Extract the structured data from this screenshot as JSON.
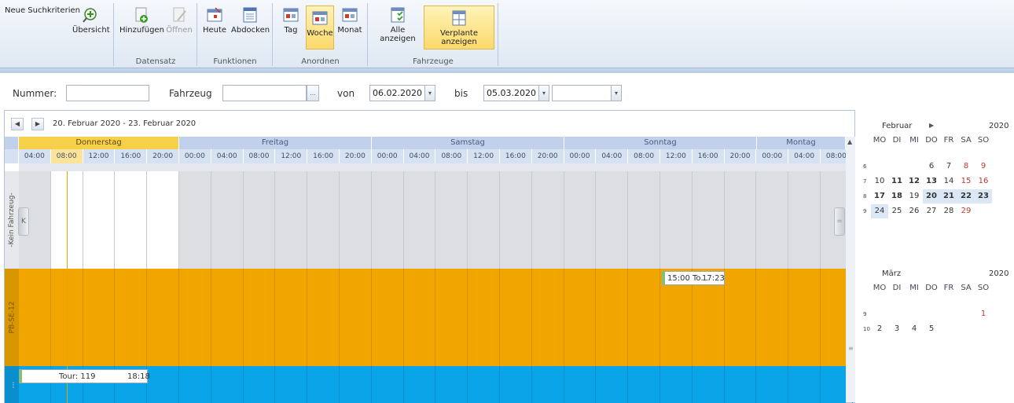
{
  "ribbon": {
    "neue_suchkriterien": "Neue Suchkriterien",
    "buttons": {
      "uebersicht": "Übersicht",
      "hinzufuegen": "Hinzufügen",
      "oeffnen": "Öffnen",
      "heute": "Heute",
      "abdocken": "Abdocken",
      "tag": "Tag",
      "woche": "Woche",
      "monat": "Monat",
      "alle_anzeigen": "Alle anzeigen",
      "verplante_anzeigen": "Verplante anzeigen"
    },
    "groups": {
      "datensatz": "Datensatz",
      "funktionen": "Funktionen",
      "anordnen": "Anordnen",
      "fahrzeuge": "Fahrzeuge"
    }
  },
  "filter": {
    "nummer_label": "Nummer:",
    "nummer_value": "",
    "fahrzeug_label": "Fahrzeug",
    "fahrzeug_value": "",
    "ellipsis": "...",
    "von_label": "von",
    "von_value": "06.02.2020",
    "bis_label": "bis",
    "bis_value": "05.03.2020",
    "extra_value": ""
  },
  "scheduler": {
    "range_label": "20. Februar 2020 - 23. Februar 2020",
    "days": [
      "Donnerstag",
      "Freitag",
      "Samstag",
      "Sonntag",
      "Montag"
    ],
    "times": [
      "04:00",
      "08:00",
      "12:00",
      "16:00",
      "20:00",
      "00:00",
      "04:00",
      "08:00",
      "12:00",
      "16:00",
      "20:00",
      "00:00",
      "04:00",
      "08:00",
      "12:00",
      "16:00",
      "20:00",
      "00:00",
      "04:00",
      "08:00",
      "12:00",
      "16:00",
      "20:00",
      "00:00",
      "04:00",
      "08:00"
    ],
    "resources": [
      "-Kein Fahrzeug-",
      "PB-SE-12",
      "..."
    ],
    "appointments": [
      {
        "title": "15:00 To...",
        "end": "17:23"
      },
      {
        "title": "Tour: 119",
        "end": "18:18"
      }
    ],
    "colors": {
      "row_empty": "#dddfe3",
      "row_orange": "#f0a500",
      "row_blue": "#0aa5e8",
      "today": "#f7d04a"
    }
  },
  "calendar": {
    "dow": [
      "MO",
      "DI",
      "MI",
      "DO",
      "FR",
      "SA",
      "SO"
    ],
    "months": [
      {
        "name": "Februar",
        "year": "2020",
        "weeks": [
          {
            "nr": "6",
            "days": [
              "",
              "",
              "",
              "6",
              "7",
              "8",
              "9"
            ]
          },
          {
            "nr": "7",
            "days": [
              "10",
              "11",
              "12",
              "13",
              "14",
              "15",
              "16"
            ]
          },
          {
            "nr": "8",
            "days": [
              "17",
              "18",
              "19",
              "20",
              "21",
              "22",
              "23"
            ]
          },
          {
            "nr": "9",
            "days": [
              "24",
              "25",
              "26",
              "27",
              "28",
              "29",
              ""
            ]
          }
        ]
      },
      {
        "name": "März",
        "year": "2020",
        "weeks": [
          {
            "nr": "9",
            "days": [
              "",
              "",
              "",
              "",
              "",
              "",
              "1"
            ]
          },
          {
            "nr": "10",
            "days": [
              "2",
              "3",
              "4",
              "5",
              "",
              "",
              ""
            ]
          }
        ]
      }
    ]
  }
}
